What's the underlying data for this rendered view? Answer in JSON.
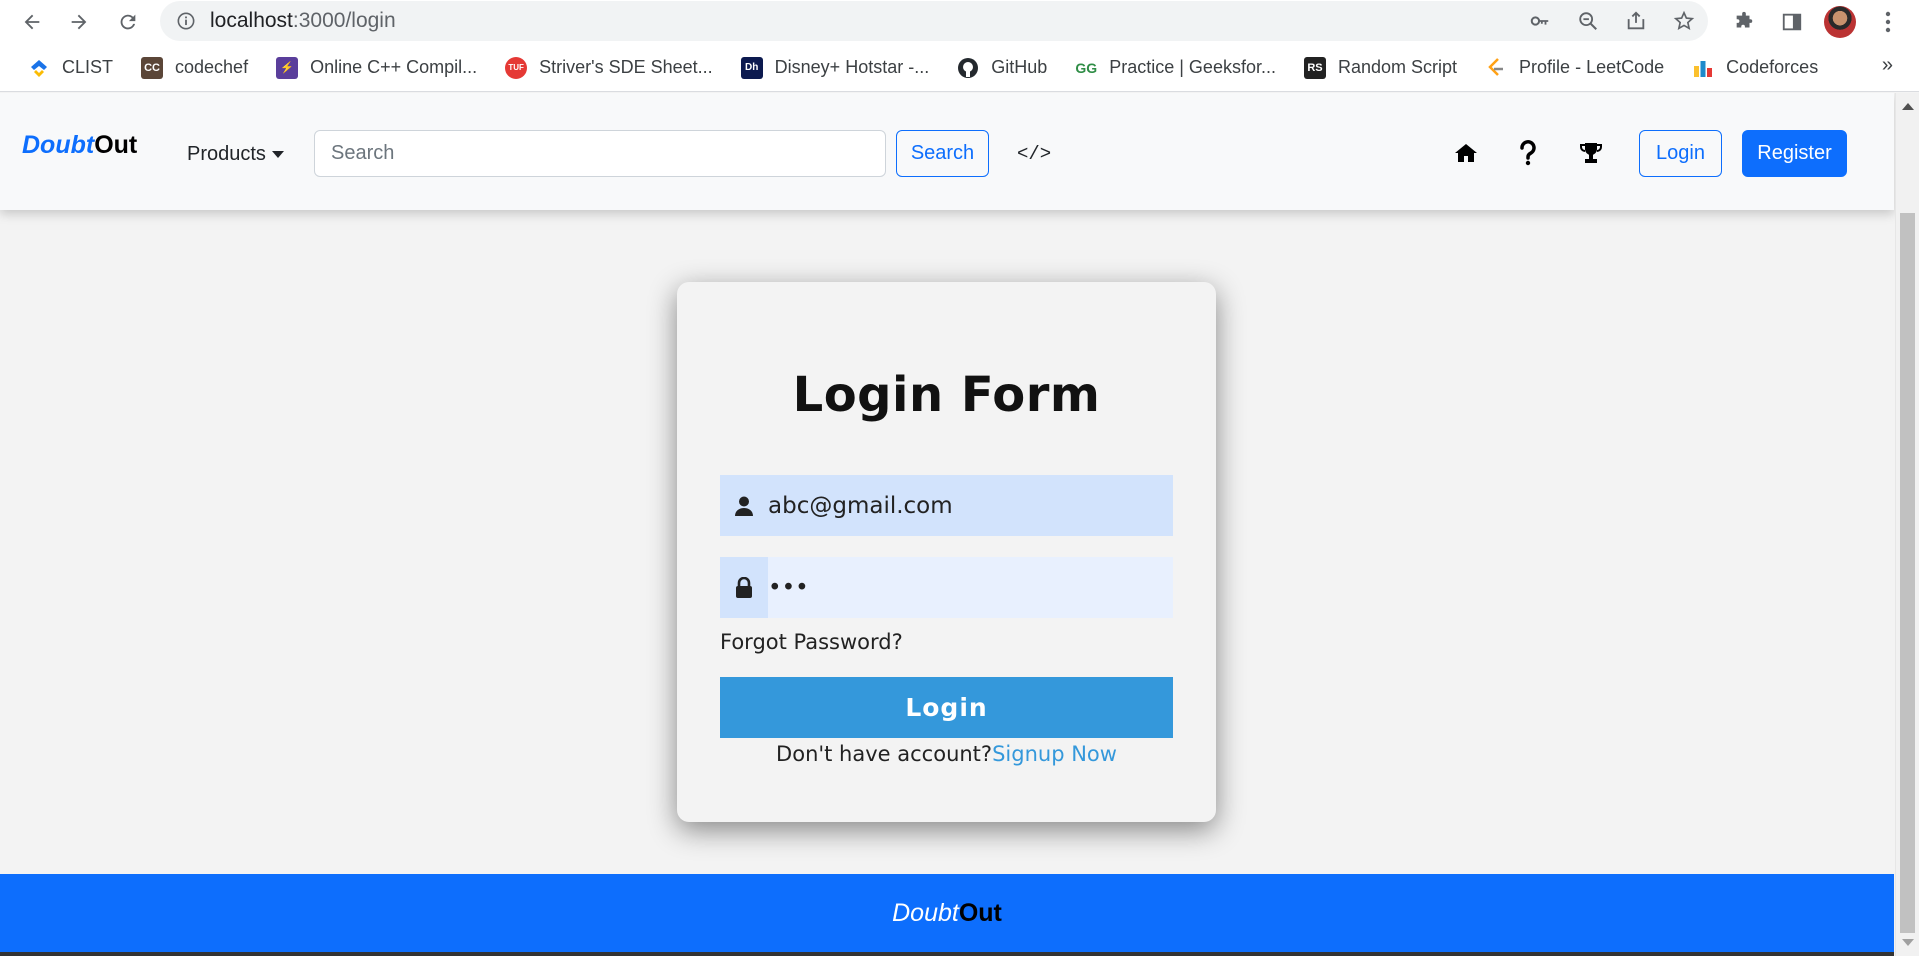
{
  "browser": {
    "url_host": "localhost",
    "url_path": ":3000/login",
    "bookmarks": [
      {
        "label": "CLIST",
        "icon": "clist-icon",
        "color": "#1a73e8"
      },
      {
        "label": "codechef",
        "icon": "codechef-icon",
        "color": "#5b4638"
      },
      {
        "label": "Online C++ Compil...",
        "icon": "compiler-icon",
        "color": "#5a3e9b"
      },
      {
        "label": "Striver's SDE Sheet...",
        "icon": "tuf-icon",
        "color": "#e53935"
      },
      {
        "label": "Disney+ Hotstar -...",
        "icon": "hotstar-icon",
        "color": "#0c1a4f"
      },
      {
        "label": "GitHub",
        "icon": "github-icon",
        "color": "#24292e"
      },
      {
        "label": "Practice | Geeksfor...",
        "icon": "gfg-icon",
        "color": "#2f8d46"
      },
      {
        "label": "Random Script",
        "icon": "rs-icon",
        "color": "#222222"
      },
      {
        "label": "Profile - LeetCode",
        "icon": "leetcode-icon",
        "color": "#ffa116"
      },
      {
        "label": "Codeforces",
        "icon": "codeforces-icon",
        "color": "#1f8acb"
      }
    ],
    "more_label": "»"
  },
  "navbar": {
    "brand_part1": "Doubt",
    "brand_part2": "Out",
    "products_label": "Products",
    "search_placeholder": "Search",
    "search_button": "Search",
    "code_label": "</>",
    "login_label": "Login",
    "register_label": "Register"
  },
  "login_form": {
    "title": "Login Form",
    "email_value": "abc@gmail.com",
    "password_value": "•••",
    "forgot_label": "Forgot Password?",
    "submit_label": "Login",
    "no_account_text": "Don't have account?",
    "signup_label": "Signup Now"
  },
  "footer": {
    "brand_part1": "Doubt",
    "brand_part2": "Out"
  },
  "colors": {
    "primary": "#0d6efd",
    "form_button": "#3498db",
    "input_bg": "#d2e3fc"
  }
}
